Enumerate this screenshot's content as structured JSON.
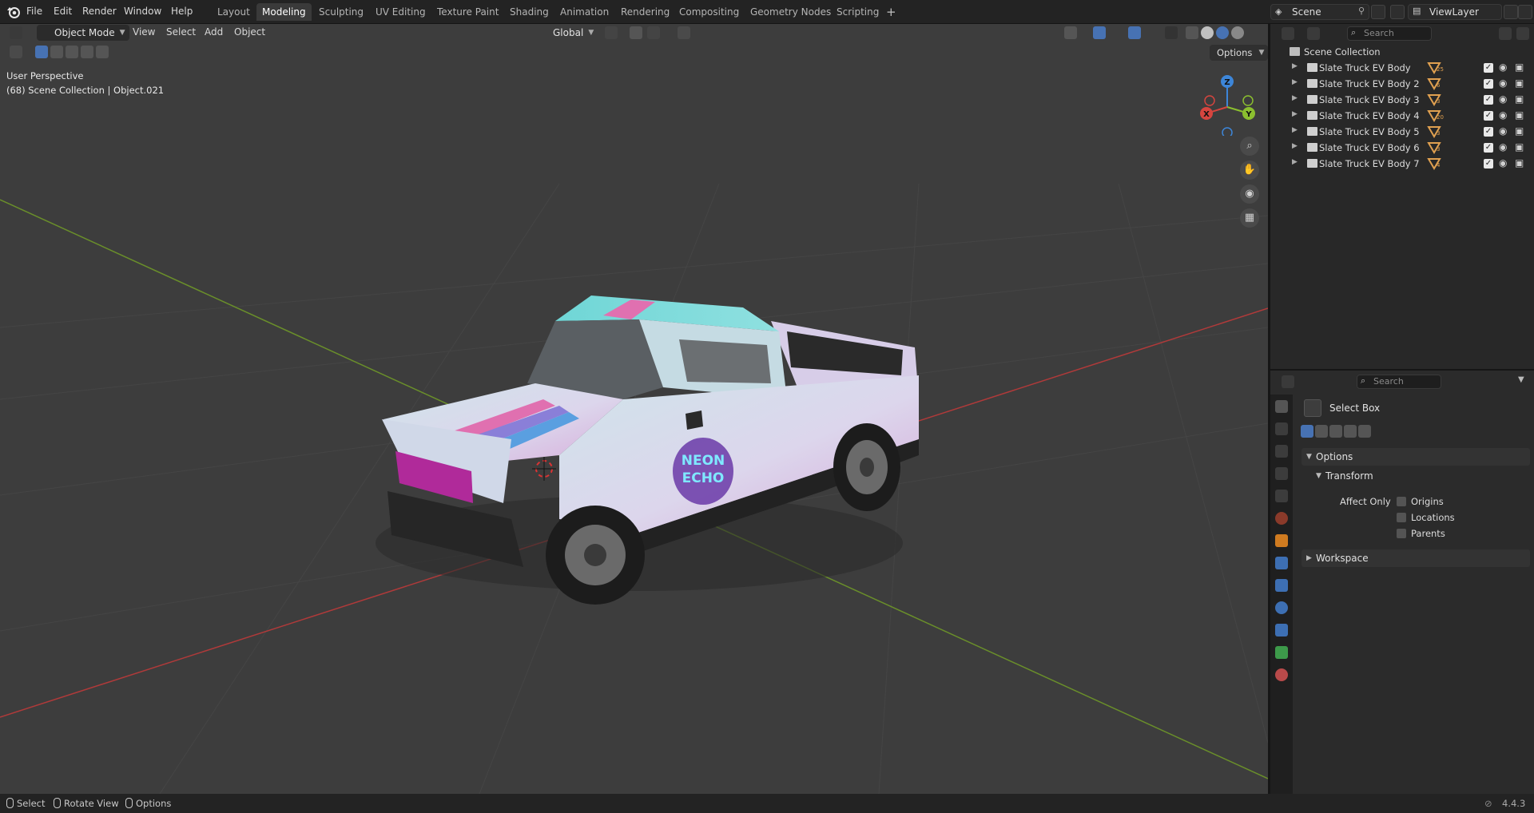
{
  "topbar": {
    "menus": [
      "File",
      "Edit",
      "Render",
      "Window",
      "Help"
    ],
    "workspaces": [
      "Layout",
      "Modeling",
      "Sculpting",
      "UV Editing",
      "Texture Paint",
      "Shading",
      "Animation",
      "Rendering",
      "Compositing",
      "Geometry Nodes",
      "Scripting"
    ],
    "active_workspace": "Modeling",
    "add_workspace": "+",
    "scene": "Scene",
    "view_layer": "ViewLayer"
  },
  "viewport": {
    "mode": "Object Mode",
    "menus": [
      "View",
      "Select",
      "Add",
      "Object"
    ],
    "orientation": "Global",
    "options_label": "Options",
    "info_line1": "User Perspective",
    "info_line2": "(68) Scene Collection | Object.021",
    "gizmo_axes": [
      "Z",
      "Y",
      "X"
    ],
    "decal_text_1": "NEON",
    "decal_text_2": "ECHO"
  },
  "outliner": {
    "search_placeholder": "Search",
    "root": "Scene Collection",
    "items": [
      {
        "name": "Slate Truck EV Body",
        "count": "25"
      },
      {
        "name": "Slate Truck EV Body 2",
        "count": "6"
      },
      {
        "name": "Slate Truck EV Body 3",
        "count": "3"
      },
      {
        "name": "Slate Truck EV Body 4",
        "count": "20"
      },
      {
        "name": "Slate Truck EV Body 5",
        "count": "3"
      },
      {
        "name": "Slate Truck EV Body 6",
        "count": "3"
      },
      {
        "name": "Slate Truck EV Body 7",
        "count": "4"
      }
    ]
  },
  "properties": {
    "search_placeholder": "Search",
    "tool_name": "Select Box",
    "panel_options": "Options",
    "panel_transform": "Transform",
    "affect_only": "Affect Only",
    "checkboxes": [
      "Origins",
      "Locations",
      "Parents"
    ],
    "panel_workspace": "Workspace"
  },
  "statusbar": {
    "items": [
      "Select",
      "Rotate View",
      "Options"
    ],
    "version": "4.4.3"
  },
  "colors": {
    "viewport_bg": "#3d3d3d",
    "active_blue": "#4772b3",
    "x_axis": "#d6453f",
    "y_axis": "#8bbf2f",
    "z_axis": "#3d86d9"
  }
}
